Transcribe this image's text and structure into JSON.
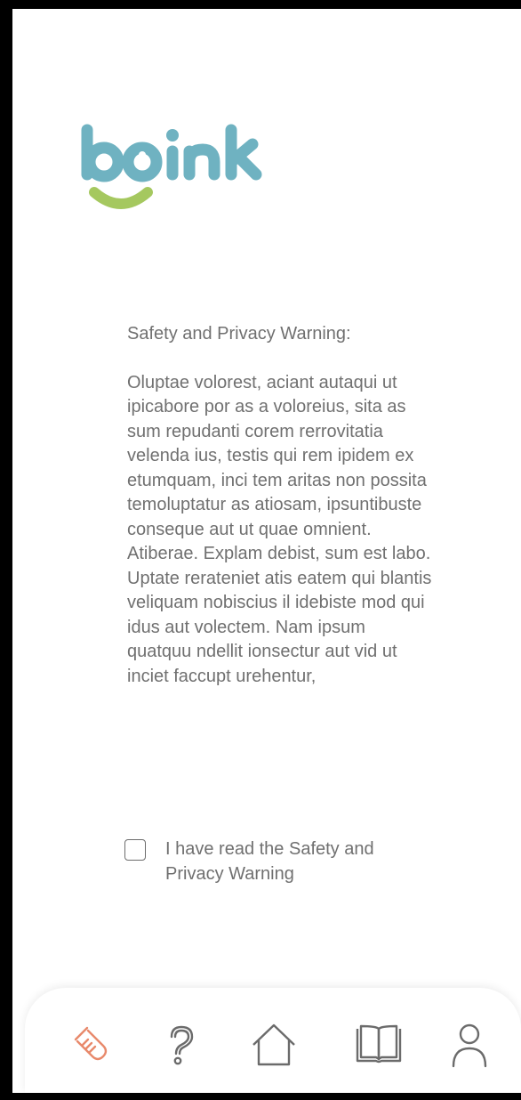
{
  "app": {
    "logo_text": "boink",
    "logo_colors": {
      "letters": "#6fb2c1",
      "smile": "#a5c85f"
    }
  },
  "warning": {
    "title": "Safety and Privacy Warning:",
    "body": "Oluptae volorest, aciant autaqui ut ipicabore por as a voloreius, sita as sum repudanti corem rerrovitatia velenda ius, testis qui rem ipidem ex etumquam, inci tem aritas non possita temoluptatur as atiosam, ipsuntibuste conseque aut ut quae omnient. Atiberae. Explam debist, sum est labo. Uptate rerateniet atis eatem qui blantis veliquam nobiscius il idebiste mod qui idus aut volectem. Nam ipsum quatquu ndellit ionsectur aut vid ut inciet faccupt urehentur,"
  },
  "consent": {
    "label": "I have read the Safety and Privacy Warning",
    "checked": false
  },
  "nav": {
    "active_color": "#e8896b",
    "icon_color": "#6b6b6b",
    "items": [
      {
        "icon": "test-tube-icon",
        "active": true
      },
      {
        "icon": "help-icon",
        "active": false
      },
      {
        "icon": "home-icon",
        "active": false
      },
      {
        "icon": "book-icon",
        "active": false
      },
      {
        "icon": "profile-icon",
        "active": false
      }
    ]
  }
}
